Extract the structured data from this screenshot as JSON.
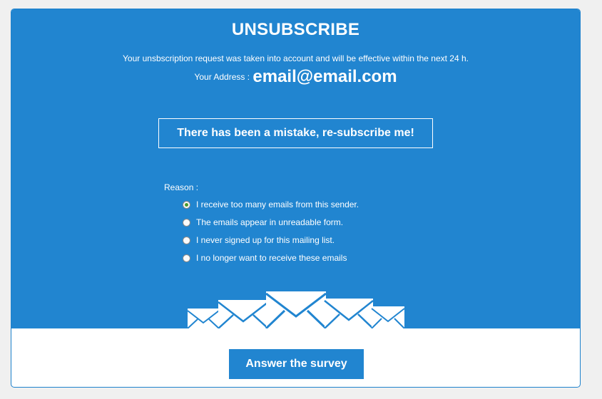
{
  "page": {
    "title": "UNSUBSCRIBE",
    "info_text": "Your unsbscription request was taken into account and will be effective within the next 24 h.",
    "address_label": "Your Address :",
    "email": "email@email.com",
    "resubscribe_label": "There has been a mistake, re-subscribe me!"
  },
  "reason": {
    "label": "Reason :",
    "options": [
      {
        "label": "I receive too many emails from this sender.",
        "checked": true
      },
      {
        "label": "The emails appear in unreadable form.",
        "checked": false
      },
      {
        "label": "I never signed up for this mailing list.",
        "checked": false
      },
      {
        "label": "I no longer want to receive these emails",
        "checked": false
      }
    ]
  },
  "survey": {
    "label": "Answer the survey"
  },
  "colors": {
    "primary_blue": "#2185d0",
    "background": "#f0f0f0",
    "card_background": "#ffffff",
    "text_on_blue": "#ffffff"
  },
  "icons": [
    "envelope-icon",
    "envelope-icon",
    "envelope-icon",
    "envelope-icon",
    "envelope-icon"
  ]
}
